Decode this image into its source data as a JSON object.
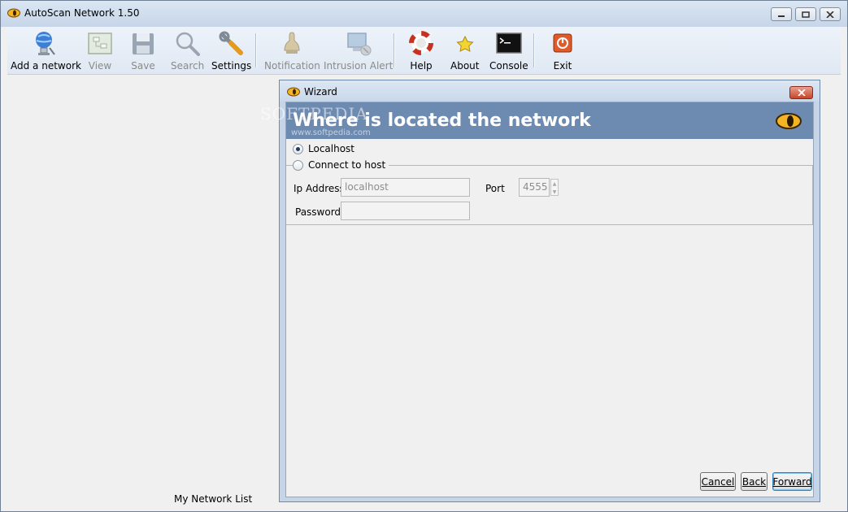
{
  "window": {
    "title": "AutoScan Network 1.50"
  },
  "toolbar": {
    "items": [
      {
        "label": "Add a network",
        "icon": "add-network-icon",
        "enabled": true
      },
      {
        "label": "View",
        "icon": "view-icon",
        "enabled": false
      },
      {
        "label": "Save",
        "icon": "save-icon",
        "enabled": false
      },
      {
        "label": "Search",
        "icon": "search-icon",
        "enabled": false
      },
      {
        "label": "Settings",
        "icon": "settings-icon",
        "enabled": true
      },
      {
        "label": "Notification",
        "icon": "notification-icon",
        "enabled": false
      },
      {
        "label": "Intrusion Alert",
        "icon": "intrusion-alert-icon",
        "enabled": false
      },
      {
        "label": "Help",
        "icon": "help-icon",
        "enabled": true
      },
      {
        "label": "About",
        "icon": "about-icon",
        "enabled": true
      },
      {
        "label": "Console",
        "icon": "console-icon",
        "enabled": true
      },
      {
        "label": "Exit",
        "icon": "exit-icon",
        "enabled": true
      }
    ]
  },
  "left_panel": {
    "label": "My Network List"
  },
  "wizard": {
    "title": "Wizard",
    "heading": "Where is located the network",
    "options": {
      "localhost": {
        "label": "Localhost",
        "selected": true
      },
      "connect": {
        "label": "Connect to host",
        "selected": false
      }
    },
    "fields": {
      "ip_label": "Ip Address",
      "ip_value": "localhost",
      "port_label": "Port",
      "port_value": "4555",
      "password_label": "Password",
      "password_value": ""
    },
    "buttons": {
      "cancel": "Cancel",
      "back": "Back",
      "forward": "Forward"
    }
  },
  "watermark": {
    "text": "SOFTPEDIA",
    "sub": "www.softpedia.com"
  },
  "colors": {
    "banner": "#6d8ab0",
    "accent": "#3c7fb1",
    "close": "#c7442a"
  }
}
